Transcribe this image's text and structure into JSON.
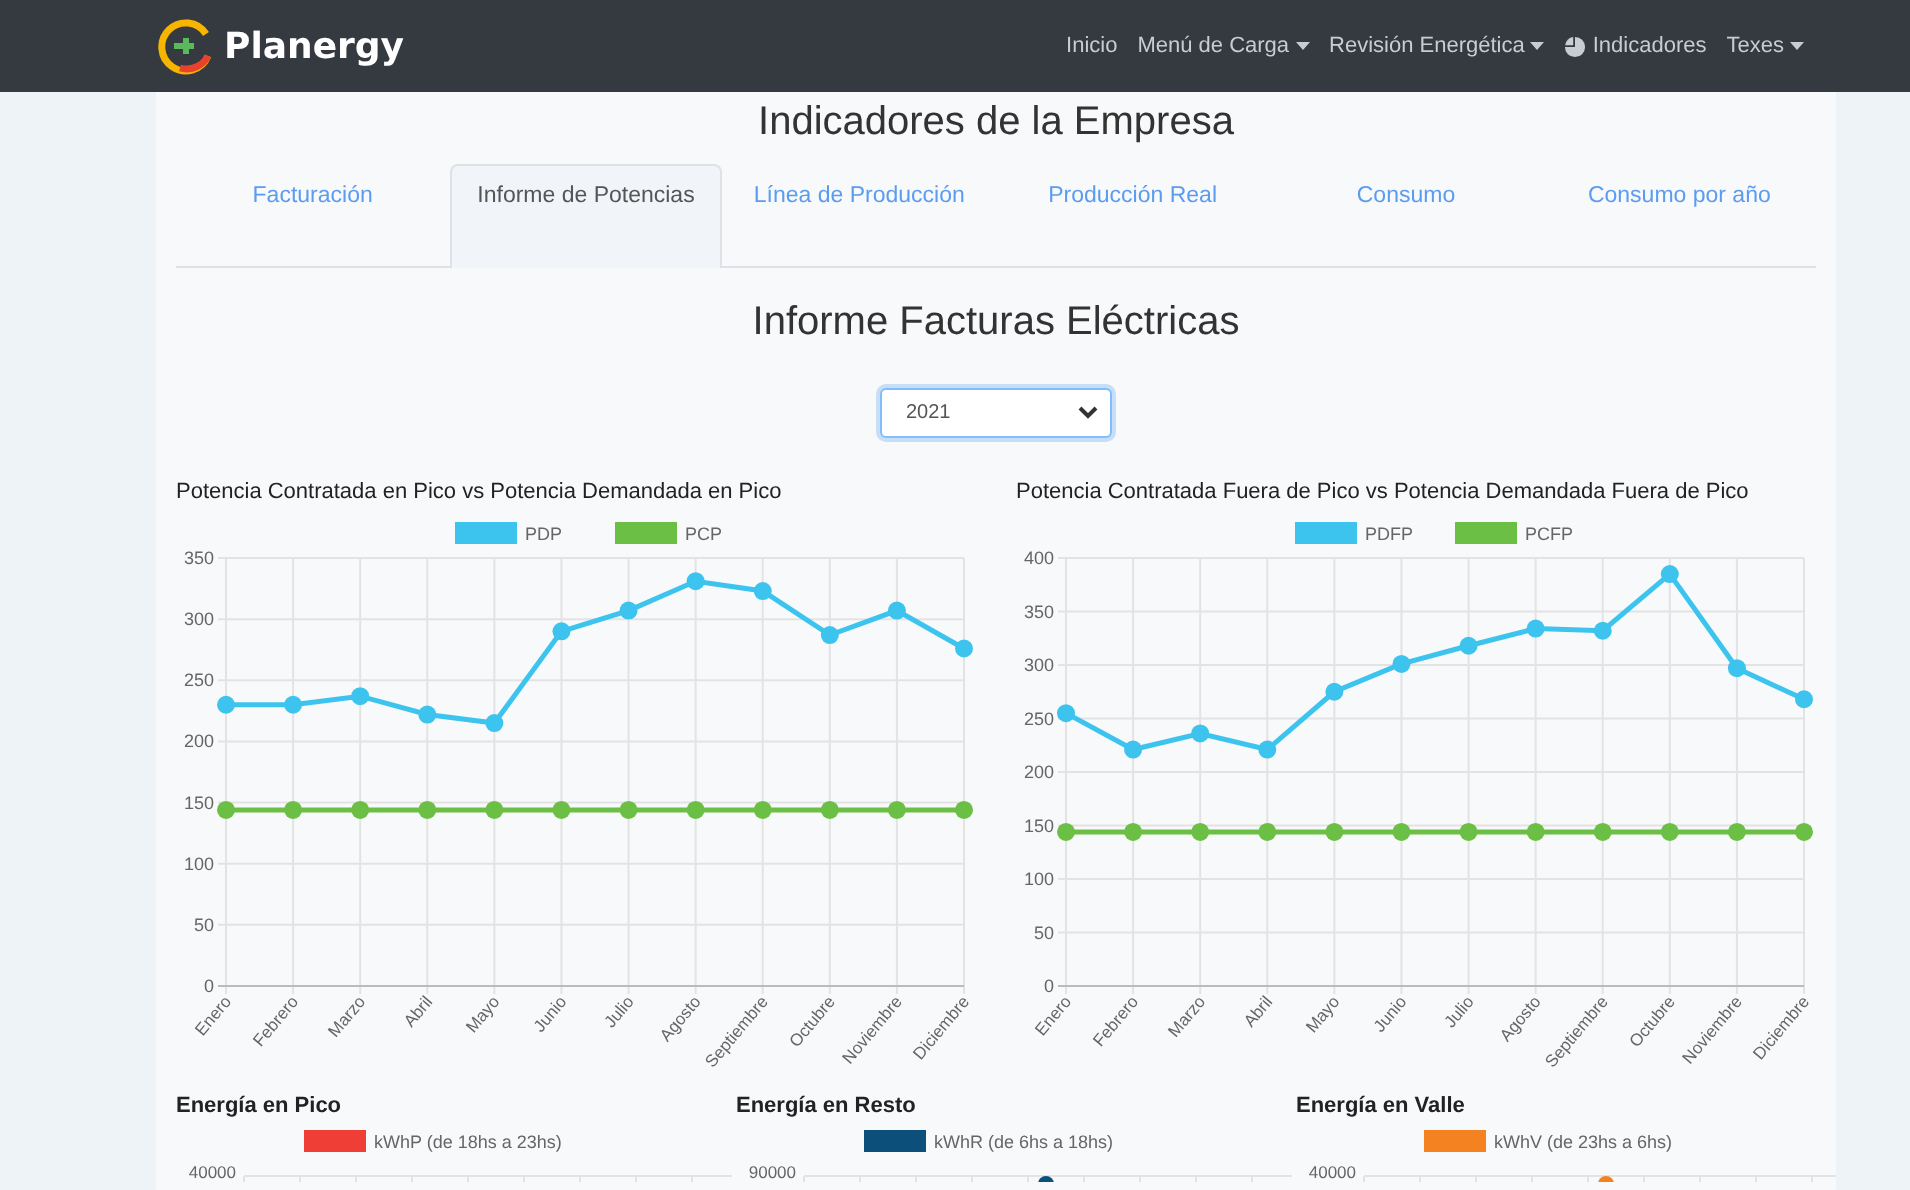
{
  "navbar": {
    "brand": "Planergy",
    "items": [
      {
        "label": "Inicio",
        "kind": "link"
      },
      {
        "label": "Menú de Carga",
        "kind": "dropdown"
      },
      {
        "label": "Revisión Energética",
        "kind": "dropdown"
      },
      {
        "label": "Indicadores",
        "kind": "icon-link"
      },
      {
        "label": "Texes",
        "kind": "dropdown"
      }
    ]
  },
  "page_title": "Indicadores de la Empresa",
  "tabs": [
    {
      "label": "Facturación",
      "selected": false
    },
    {
      "label": "Informe de Potencias",
      "selected": true
    },
    {
      "label": "Línea de Producción",
      "selected": false
    },
    {
      "label": "Producción Real",
      "selected": false
    },
    {
      "label": "Consumo",
      "selected": false
    },
    {
      "label": "Consumo por año",
      "selected": false
    }
  ],
  "section_title": "Informe Facturas Eléctricas",
  "year_select": {
    "value": "2021"
  },
  "charts": [
    {
      "chart_data": {
        "type": "line",
        "title": "Potencia Contratada en Pico vs Potencia Demandada en Pico",
        "categories": [
          "Enero",
          "Febrero",
          "Marzo",
          "Abril",
          "Mayo",
          "Junio",
          "Julio",
          "Agosto",
          "Septiembre",
          "Octubre",
          "Noviembre",
          "Diciembre"
        ],
        "ylim": [
          0,
          350
        ],
        "grid": true,
        "legend": true,
        "yticks": [
          0,
          50,
          100,
          150,
          200,
          250,
          300,
          350
        ],
        "series": [
          {
            "name": "PDP",
            "color": "#3cc4ee",
            "marker": "circle",
            "values": [
              230,
              230,
              237,
              222,
              215,
              290,
              307,
              331,
              323,
              287,
              307,
              276
            ]
          },
          {
            "name": "PCP",
            "color": "#6cbf45",
            "marker": "circle",
            "values": [
              144,
              144,
              144,
              144,
              144,
              144,
              144,
              144,
              144,
              144,
              144,
              144
            ]
          }
        ]
      }
    },
    {
      "chart_data": {
        "type": "line",
        "title": "Potencia Contratada Fuera de Pico vs Potencia Demandada Fuera de Pico",
        "categories": [
          "Enero",
          "Febrero",
          "Marzo",
          "Abril",
          "Mayo",
          "Junio",
          "Julio",
          "Agosto",
          "Septiembre",
          "Octubre",
          "Noviembre",
          "Diciembre"
        ],
        "ylim": [
          0,
          400
        ],
        "grid": true,
        "legend": true,
        "yticks": [
          0,
          50,
          100,
          150,
          200,
          250,
          300,
          350,
          400
        ],
        "series": [
          {
            "name": "PDFP",
            "color": "#3cc4ee",
            "marker": "circle",
            "values": [
              255,
              221,
              236,
              221,
              275,
              301,
              318,
              334,
              332,
              385,
              297,
              268
            ]
          },
          {
            "name": "PCFP",
            "color": "#6cbf45",
            "marker": "circle",
            "values": [
              144,
              144,
              144,
              144,
              144,
              144,
              144,
              144,
              144,
              144,
              144,
              144
            ]
          }
        ]
      }
    }
  ],
  "energy_charts": [
    {
      "title": "Energía en Pico",
      "legend": "kWhP (de 18hs a 23hs)",
      "color": "#ef3e36",
      "top_tick": "40000"
    },
    {
      "title": "Energía en Resto",
      "legend": "kWhR (de 6hs a 18hs)",
      "color": "#0c4f7a",
      "top_tick": "90000",
      "point_visible": true
    },
    {
      "title": "Energía en Valle",
      "legend": "kWhV (de 23hs a 6hs)",
      "color": "#f58220",
      "top_tick": "40000",
      "point_visible": true
    }
  ]
}
